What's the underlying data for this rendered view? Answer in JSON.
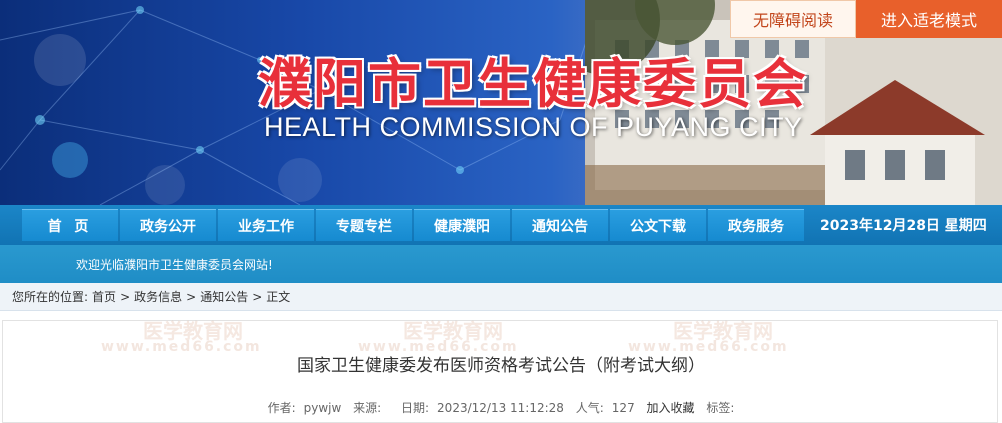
{
  "header": {
    "title": "濮阳市卫生健康委员会",
    "subtitle": "HEALTH  COMMISSION OF PUYANG CITY",
    "accessibility_label": "无障碍阅读",
    "elderly_mode_label": "进入适老模式"
  },
  "nav": {
    "items": [
      {
        "label": "首  页"
      },
      {
        "label": "政务公开"
      },
      {
        "label": "业务工作"
      },
      {
        "label": "专题专栏"
      },
      {
        "label": "健康濮阳"
      },
      {
        "label": "通知公告"
      },
      {
        "label": "公文下载"
      },
      {
        "label": "政务服务"
      }
    ],
    "date": "2023年12月28日 星期四"
  },
  "notice": {
    "text": "欢迎光临濮阳市卫生健康委员会网站!"
  },
  "breadcrumb": {
    "prefix": "您所在的位置:",
    "items": [
      "首页",
      "政务信息",
      "通知公告",
      "正文"
    ],
    "separator": ">"
  },
  "article": {
    "title": "国家卫生健康委发布医师资格考试公告（附考试大纲）",
    "author_label": "作者:",
    "author": "pywjw",
    "source_label": "来源:",
    "source": "",
    "date_label": "日期:",
    "date": "2023/12/13 11:12:28",
    "views_label": "人气:",
    "views": "127",
    "favorite_label": "加入收藏",
    "tags_label": "标签:"
  },
  "watermark": {
    "text": "医学教育网",
    "url": "www.med66.com"
  },
  "colors": {
    "nav_blue": "#1b86c8",
    "title_red": "#e8303a",
    "accent_orange": "#e8602b"
  }
}
